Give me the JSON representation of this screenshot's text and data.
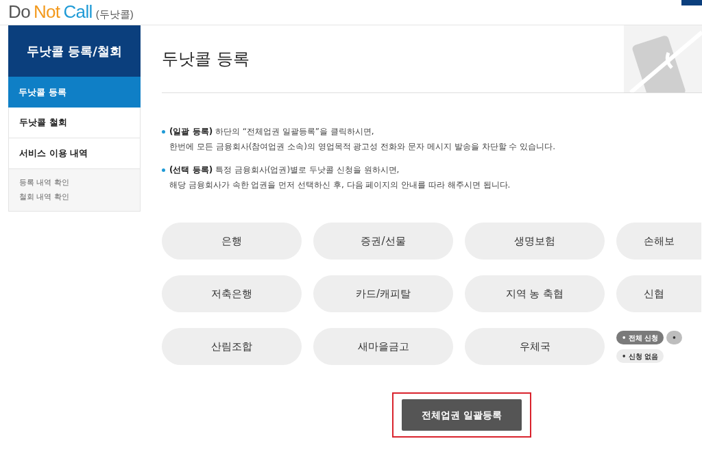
{
  "logo": {
    "parts": [
      {
        "text": "Do",
        "color": "#555555"
      },
      {
        "text": "Not",
        "color": "#f39a1e"
      },
      {
        "text": "Call",
        "color": "#1e9ad6"
      },
      {
        "text": "(두낫콜)",
        "color": "#555555"
      }
    ]
  },
  "sidebar": {
    "title": "두낫콜 등록/철회",
    "items": [
      {
        "label": "두낫콜 등록",
        "selected": true
      },
      {
        "label": "두낫콜 철회",
        "selected": false
      },
      {
        "label": "서비스 이용 내역",
        "selected": false
      }
    ],
    "sub_items": [
      "등록 내역 확인",
      "철회 내역 확인"
    ]
  },
  "page_title": "두낫콜 등록",
  "notes": [
    {
      "lead": "(일괄 등록)",
      "line1": "하단의 “전체업권 일괄등록”을 클릭하시면,",
      "line2": "한번에 모든 금융회사(참여업권 소속)의 영업목적 광고성 전화와 문자 메시지 발송을 차단할 수 있습니다."
    },
    {
      "lead": "(선택 등록)",
      "line1": "특정 금융회사(업권)별로 두낫콜 신청을 원하시면,",
      "line2": "해당 금융회사가 속한 업권을 먼저 선택하신 후, 다음 페이지의 안내를 따라 해주시면 됩니다."
    }
  ],
  "sectors": [
    "은행",
    "증권/선물",
    "생명보험",
    "손해보",
    "저축은행",
    "카드/캐피탈",
    "지역 농 축협",
    "신협",
    "산림조합",
    "새마을금고",
    "우체국"
  ],
  "legend": [
    {
      "label": "• 전체 신청",
      "color": "#7a7a7a"
    },
    {
      "label": "•",
      "color": "#bdbdbd"
    },
    {
      "label": "• 신청 없음",
      "color": "#ececec"
    }
  ],
  "submit_button": "전체업권 일괄등록"
}
